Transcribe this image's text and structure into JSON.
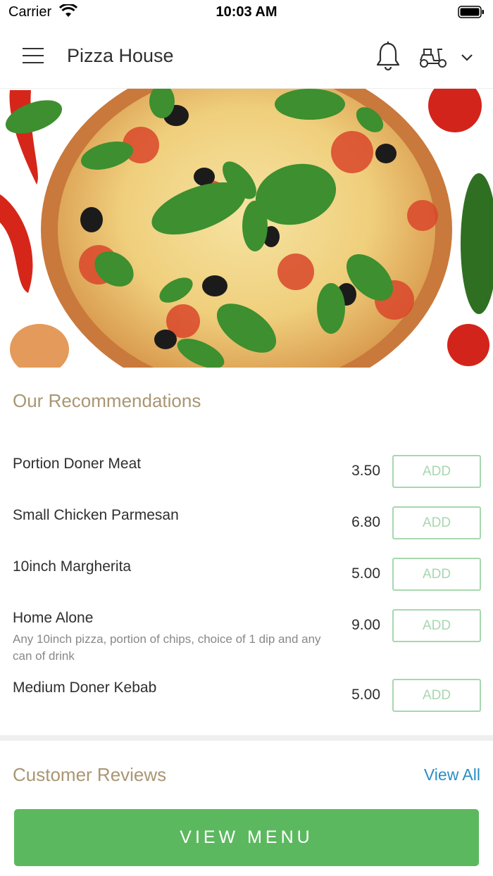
{
  "status_bar": {
    "carrier": "Carrier",
    "time": "10:03 AM"
  },
  "header": {
    "title": "Pizza House",
    "icons": [
      "hamburger-menu-icon",
      "bell-icon",
      "scooter-icon",
      "chevron-down-icon"
    ]
  },
  "recommendations": {
    "title": "Our Recommendations",
    "items": [
      {
        "name": "Portion Doner Meat",
        "desc": "",
        "price": "3.50",
        "add_label": "ADD"
      },
      {
        "name": "Small Chicken Parmesan",
        "desc": "",
        "price": "6.80",
        "add_label": "ADD"
      },
      {
        "name": "10inch Margherita",
        "desc": "",
        "price": "5.00",
        "add_label": "ADD"
      },
      {
        "name": "Home Alone",
        "desc": "Any 10inch pizza, portion of chips, choice of 1 dip and any can of drink",
        "price": "9.00",
        "add_label": "ADD"
      },
      {
        "name": "Medium Doner Kebab",
        "desc": "",
        "price": "5.00",
        "add_label": "ADD"
      }
    ]
  },
  "reviews": {
    "title": "Customer Reviews",
    "view_all": "View All"
  },
  "footer": {
    "view_menu": "VIEW MENU"
  },
  "colors": {
    "accent_green": "#5cb85f",
    "add_border": "#a7d8ae",
    "section_title": "#a99673",
    "link_blue": "#2a8ec4"
  }
}
